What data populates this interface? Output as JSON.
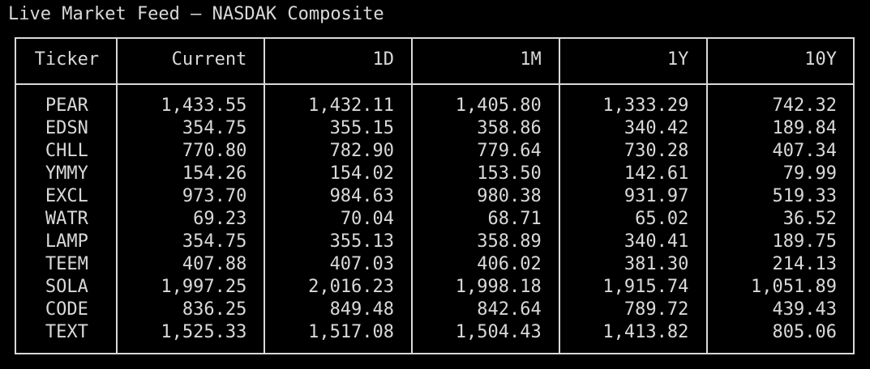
{
  "window": {
    "title": "Live Market Feed – NASDAK Composite"
  },
  "table": {
    "columns": [
      "Ticker",
      "Current",
      "1D",
      "1M",
      "1Y",
      "10Y"
    ],
    "rows": [
      [
        "PEAR",
        "1,433.55",
        "1,432.11",
        "1,405.80",
        "1,333.29",
        "742.32"
      ],
      [
        "EDSN",
        "354.75",
        "355.15",
        "358.86",
        "340.42",
        "189.84"
      ],
      [
        "CHLL",
        "770.80",
        "782.90",
        "779.64",
        "730.28",
        "407.34"
      ],
      [
        "YMMY",
        "154.26",
        "154.02",
        "153.50",
        "142.61",
        "79.99"
      ],
      [
        "EXCL",
        "973.70",
        "984.63",
        "980.38",
        "931.97",
        "519.33"
      ],
      [
        "WATR",
        "69.23",
        "70.04",
        "68.71",
        "65.02",
        "36.52"
      ],
      [
        "LAMP",
        "354.75",
        "355.13",
        "358.89",
        "340.41",
        "189.75"
      ],
      [
        "TEEM",
        "407.88",
        "407.03",
        "406.02",
        "381.30",
        "214.13"
      ],
      [
        "SOLA",
        "1,997.25",
        "2,016.23",
        "1,998.18",
        "1,915.74",
        "1,051.89"
      ],
      [
        "CODE",
        "836.25",
        "849.48",
        "842.64",
        "789.72",
        "439.43"
      ],
      [
        "TEXT",
        "1,525.33",
        "1,517.08",
        "1,504.43",
        "1,413.82",
        "805.06"
      ]
    ]
  },
  "colors": {
    "background": "#000000",
    "foreground": "#d9d9d9"
  }
}
